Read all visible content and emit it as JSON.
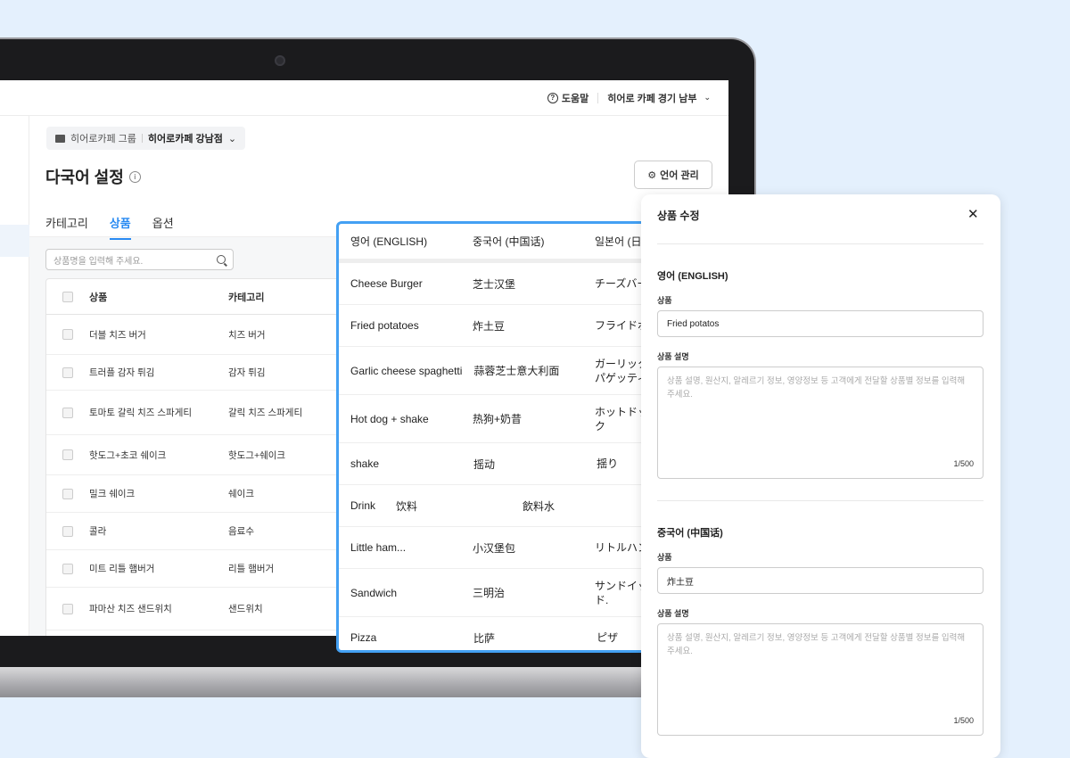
{
  "topbar": {
    "help": "도움말",
    "store": "히어로 카페 경기 남부"
  },
  "group_pill": {
    "group": "히어로카페 그룹",
    "store": "히어로카페 강남점"
  },
  "page": {
    "title": "다국어 설정",
    "lang_manage": "언어 관리"
  },
  "tabs": [
    "카테고리",
    "상품",
    "옵션"
  ],
  "search": {
    "placeholder": "상품명을 입력해 주세요."
  },
  "table": {
    "headers": [
      "상품",
      "카테고리"
    ],
    "rows": [
      [
        "더블 치즈 버거",
        "치즈 버거"
      ],
      [
        "트러플 감자 튀김",
        "감자 튀김"
      ],
      [
        "토마토 갈릭 치즈 스파게티",
        "갈릭 치즈 스파게티"
      ],
      [
        "핫도그+초코 쉐이크",
        "핫도그+쉐이크"
      ],
      [
        "밀크 쉐이크",
        "쉐이크"
      ],
      [
        "콜라",
        "음료수"
      ],
      [
        "미트 리틀 햄버거",
        "리틀 햄버거"
      ],
      [
        "파마산 치즈 샌드위치",
        "샌드위치"
      ]
    ]
  },
  "translations": {
    "headers": [
      "영어 (ENGLISH)",
      "중국어 (中国话)",
      "일본어 (日本語)"
    ],
    "rows": [
      [
        "Cheese Burger",
        "芝士汉堡",
        "チーズバーガー"
      ],
      [
        "Fried potatoes",
        "炸土豆",
        "フライドポテト"
      ],
      [
        "Garlic cheese spaghetti",
        "蒜蓉芝士意大利面",
        "ガーリックチーズ\nパゲッティ"
      ],
      [
        "Hot dog + shake",
        "热狗+奶昔",
        "ホットドッグ+シェイ\nク"
      ],
      [
        "shake",
        "摇动",
        "揺り"
      ],
      [
        "Drink",
        "饮料",
        "飲料水"
      ],
      [
        "Little ham...",
        "小汉堡包",
        "リトルハンバーガー"
      ],
      [
        "Sandwich",
        "三明治",
        "サンドイッチ\nド."
      ],
      [
        "Pizza",
        "比萨",
        "ピザ"
      ]
    ]
  },
  "modal": {
    "title": "상품 수정",
    "sections": [
      {
        "lang": "영어 (ENGLISH)",
        "product_label": "상품",
        "product_value": "Fried potatos",
        "desc_label": "상품 설명",
        "desc_placeholder": "상품 설명, 원산지, 알레르기 정보, 영양정보 등 고객에게 전달할 상품별 정보를 입력해 주세요.",
        "count": "1/500"
      },
      {
        "lang": "중국어 (中国话)",
        "product_label": "상품",
        "product_value": "炸土豆",
        "desc_label": "상품 설명",
        "desc_placeholder": "상품 설명, 원산지, 알레르기 정보, 영양정보 등 고객에게 전달할 상품별 정보를 입력해 주세요.",
        "count": "1/500"
      }
    ]
  }
}
